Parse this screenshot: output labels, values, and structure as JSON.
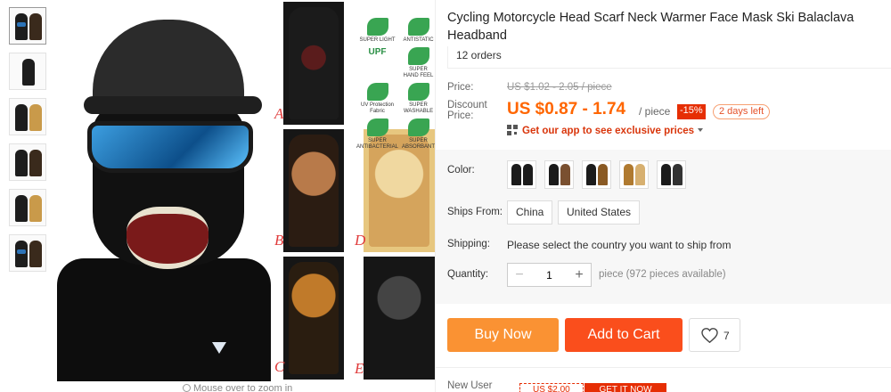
{
  "product": {
    "title": "Cycling Motorcycle Head Scarf Neck Warmer Face Mask Ski Balaclava Headband",
    "orders": "12 orders"
  },
  "gallery": {
    "thumbnails": [
      "thumb-1",
      "thumb-2",
      "thumb-3",
      "thumb-4",
      "thumb-5",
      "thumb-6"
    ],
    "tile_labels": [
      "A",
      "B",
      "C",
      "D",
      "E"
    ],
    "features": [
      {
        "label": "SUPER LIGHT",
        "icon": "feather-icon"
      },
      {
        "label": "ANTISTATIC",
        "icon": "lightning-icon"
      },
      {
        "label": "UPF",
        "icon": "upf-icon"
      },
      {
        "label": "SUPER HAND FEEL",
        "icon": "hand-icon"
      },
      {
        "label": "UV Protection Fabric",
        "icon": "uv-icon"
      },
      {
        "label": "SUPER WASHABLE",
        "icon": "wash-icon"
      },
      {
        "label": "SUPER ANTIBACTERIAL",
        "icon": "antibacterial-icon"
      },
      {
        "label": "SUPER ABSORBANT",
        "icon": "drop-icon"
      }
    ],
    "zoom_hint": "Mouse over to zoom in"
  },
  "pricing": {
    "price_label": "Price:",
    "original_price": "US $1.02 - 2.05 / piece",
    "discount_label_1": "Discount",
    "discount_label_2": "Price:",
    "discount_price": "US $0.87 - 1.74",
    "per": "/ piece",
    "discount_badge": "-15%",
    "time_left": "2 days left",
    "app_promo": "Get our app to see exclusive prices"
  },
  "options": {
    "color_label": "Color:",
    "color_count": 5,
    "ships_from_label": "Ships From:",
    "ships_from_options": [
      "China",
      "United States"
    ],
    "shipping_label": "Shipping:",
    "shipping_message": "Please select the country you want to ship from",
    "quantity_label": "Quantity:",
    "quantity_value": "1",
    "quantity_note": "piece (972 pieces available)",
    "minus": "−",
    "plus": "+"
  },
  "actions": {
    "buy_now": "Buy Now",
    "add_to_cart": "Add to Cart",
    "wishlist_count": "7"
  },
  "new_user": {
    "label": "New User",
    "coupon": "US $2.00",
    "cta": "GET IT NOW"
  },
  "colors": {
    "price": "#ff6600",
    "buy_now": "#fa9233",
    "add_to_cart": "#fa4e1c",
    "discount": "#e62e04"
  }
}
